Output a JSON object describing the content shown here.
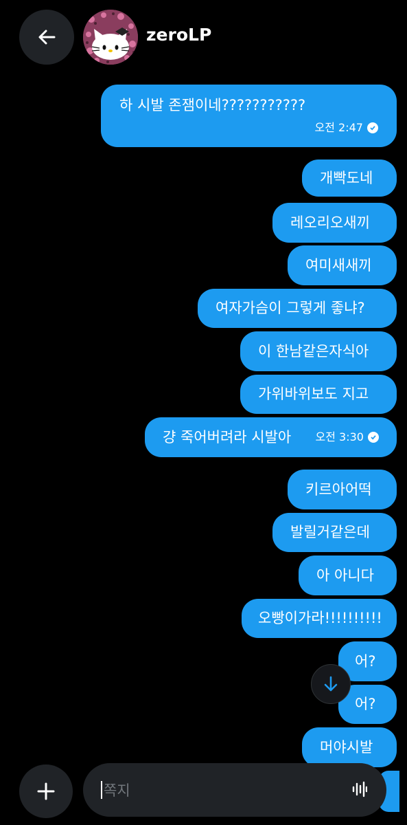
{
  "header": {
    "username": "zeroLP",
    "back_icon": "arrow-left-icon",
    "avatar_description": "hello-kitty-avatar"
  },
  "messages": [
    {
      "text": "하 시발 존잼이네???????????",
      "time": "오전 2:47",
      "read": true
    },
    {
      "text": "개빡도네"
    },
    {
      "text": "레오리오새끼"
    },
    {
      "text": "여미새새끼"
    },
    {
      "text": "여자가슴이 그렇게 좋냐?"
    },
    {
      "text": "이 한남같은자식아"
    },
    {
      "text": "가위바위보도 지고"
    },
    {
      "text": "걍 죽어버려라 시발아",
      "time": "오전 3:30",
      "read": true
    },
    {
      "text": "키르아어떡"
    },
    {
      "text": "발릴거같은데"
    },
    {
      "text": "아 아니다"
    },
    {
      "text": "오빵이가라!!!!!!!!!!"
    },
    {
      "text": "어?"
    },
    {
      "text": "어?"
    },
    {
      "text": "머야시발"
    }
  ],
  "composer": {
    "placeholder": "쪽지",
    "add_icon": "plus-icon",
    "voice_icon": "waveform-icon"
  },
  "scroll_down_icon": "arrow-down-icon",
  "colors": {
    "background": "#000000",
    "bubble": "#1d9bf0",
    "control_bg": "#202327",
    "placeholder": "#71767b"
  }
}
